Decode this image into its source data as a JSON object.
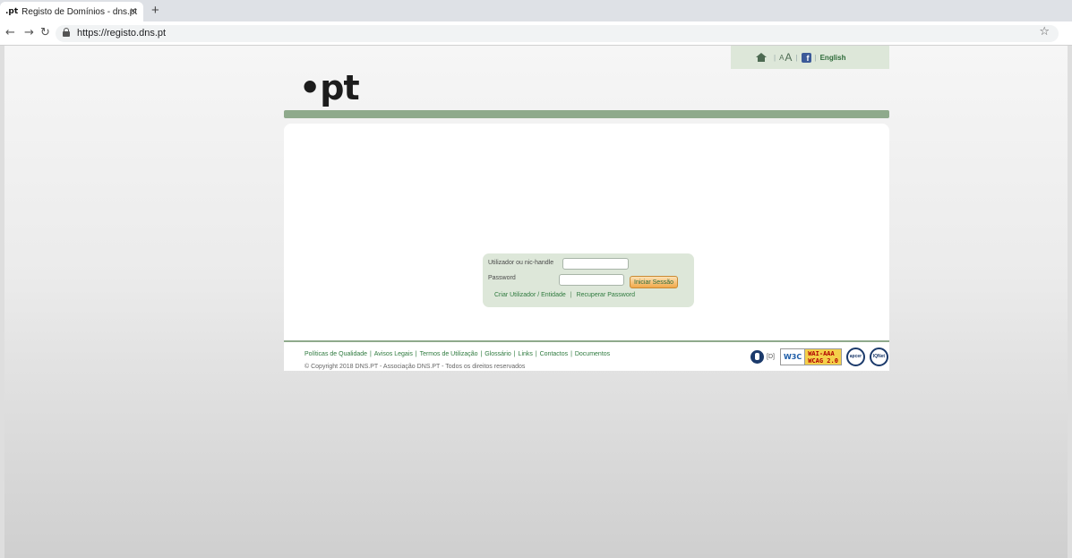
{
  "browser": {
    "tab_title": "Registo de Domínios - dns.pt",
    "tab_favicon": ".pt",
    "url": "https://registo.dns.pt"
  },
  "topbar": {
    "font_small": "A",
    "font_big": "A",
    "facebook": "f",
    "language_link": "English"
  },
  "logo": {
    "text": "•pt"
  },
  "login": {
    "username_label": "Utilizador ou nic-handle",
    "username_value": "",
    "password_label": "Password",
    "password_value": "",
    "submit_label": "Iniciar Sessão",
    "create_user_link": "Criar Utilizador / Entidade",
    "recover_password_link": "Recuperar Password"
  },
  "footer": {
    "links": [
      "Políticas de Qualidade",
      "Avisos Legais",
      "Termos de Utilização",
      "Glossário",
      "Links",
      "Contactos",
      "Documentos"
    ],
    "copyright": "© Copyright 2018 DNS.PT - Associação DNS.PT - Todos os direitos reservados",
    "d_link": "[D]",
    "w3c_text": "W3C",
    "wcag_line1": "WAI-AAA",
    "wcag_line2": "WCAG 2.0",
    "seal1_text": "apcer",
    "seal2_text": "IQNet"
  },
  "colors": {
    "accent_green": "#8faa8c",
    "panel_green": "#dde7d9",
    "link_green": "#2e7a3e",
    "button_orange": "#f1a94a"
  }
}
